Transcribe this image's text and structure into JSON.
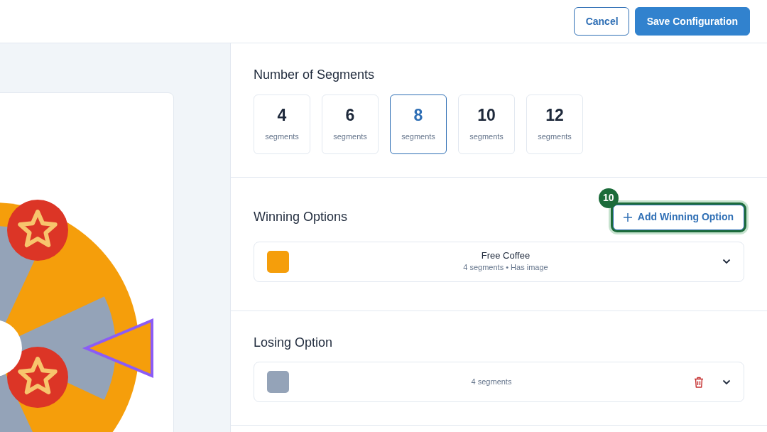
{
  "header": {
    "buttons": [
      {
        "label": "Cancel",
        "kind": "outline"
      },
      {
        "label": "Save Configuration",
        "kind": "primary"
      }
    ]
  },
  "segments": {
    "title": "Number of Segments",
    "options": [
      {
        "value": "4",
        "unit": "segments",
        "selected": false
      },
      {
        "value": "6",
        "unit": "segments",
        "selected": false
      },
      {
        "value": "8",
        "unit": "segments",
        "selected": true
      },
      {
        "value": "10",
        "unit": "segments",
        "selected": false
      },
      {
        "value": "12",
        "unit": "segments",
        "selected": false
      }
    ]
  },
  "winning": {
    "title": "Winning Options",
    "add_button": {
      "label": "Add Winning Option",
      "badge": "10",
      "highlighted": true
    },
    "items": [
      {
        "name": "Free Coffee",
        "meta": "4 segments • Has image",
        "color": "#f59e0b",
        "deletable": false
      }
    ]
  },
  "losing": {
    "title": "Losing Option",
    "items": [
      {
        "meta": "4 segments",
        "color": "#94a3b8",
        "deletable": true
      }
    ]
  }
}
